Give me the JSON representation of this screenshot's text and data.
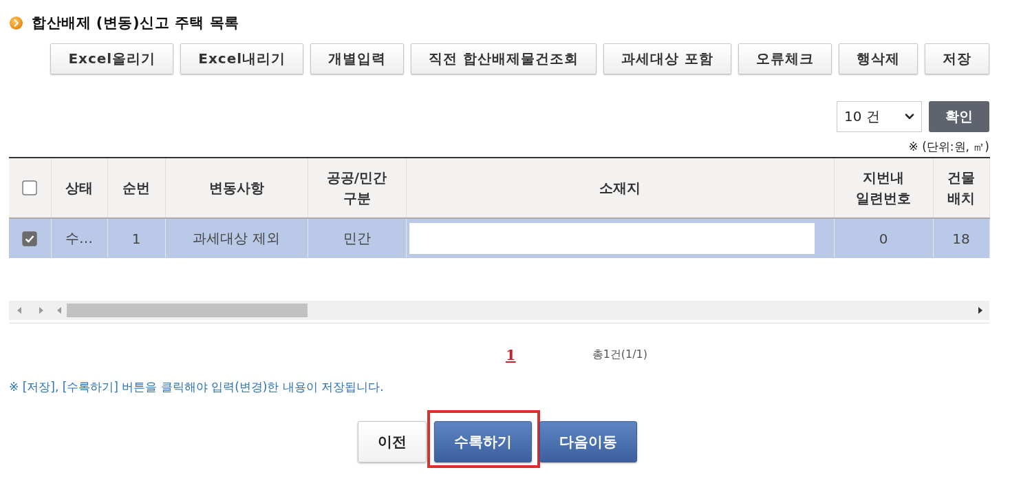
{
  "title": "합산배제 (변동)신고 주택 목록",
  "toolbar": {
    "buttons": [
      "Excel올리기",
      "Excel내리기",
      "개별입력",
      "직전 합산배제물건조회",
      "과세대상 포함",
      "오류체크",
      "행삭제",
      "저장"
    ]
  },
  "page_size": {
    "value": "10 건",
    "confirm": "확인"
  },
  "unit_note": "※ (단위:원, ㎡)",
  "table": {
    "header_checkbox": {
      "checked": false
    },
    "columns": [
      "상태",
      "순번",
      "변동사항",
      "공공/민간\n구분",
      "소재지",
      "지번내\n일련번호",
      "건물\n배치"
    ],
    "rows": [
      {
        "selected": true,
        "checked": true,
        "cells": [
          {
            "kind": "text",
            "text": "수…"
          },
          {
            "kind": "text",
            "text": "1"
          },
          {
            "kind": "text",
            "text": "과세대상 제외"
          },
          {
            "kind": "text",
            "text": "민간"
          },
          {
            "kind": "input"
          },
          {
            "kind": "text",
            "text": "0"
          },
          {
            "kind": "text",
            "text": "18"
          }
        ]
      }
    ]
  },
  "pagination": {
    "pages": [
      {
        "label": "1",
        "selected": true
      }
    ],
    "total": "총1건(1/1)"
  },
  "notice": "※ [저장], [수록하기] 버튼을 클릭해야 입력(변경)한 내용이 저장됩니다.",
  "actions": [
    {
      "label": "이전",
      "kind": "secondary",
      "highlighted": false
    },
    {
      "label": "수록하기",
      "kind": "primary",
      "highlighted": true
    },
    {
      "label": "다음이동",
      "kind": "primary",
      "highlighted": false
    }
  ]
}
